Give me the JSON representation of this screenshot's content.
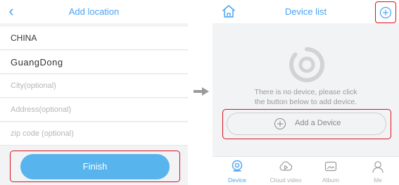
{
  "left_screen": {
    "title": "Add location",
    "back_icon": "chevron-left-icon",
    "fields": {
      "country": "CHINA",
      "province": "GuangDong",
      "city_placeholder": "City(optional)",
      "address_placeholder": "Address(optional)",
      "zip_placeholder": "zip code (optional)"
    },
    "finish_label": "Finish"
  },
  "arrow_icon": "right-arrow-icon",
  "right_screen": {
    "title": "Device list",
    "home_icon": "home-icon",
    "add_icon": "plus-circle-icon",
    "empty_message_line1": "There is no device, please click",
    "empty_message_line2": "the button below to add device.",
    "add_device_label": "Add a Device",
    "tabs": [
      {
        "label": "Device",
        "icon": "camera-icon",
        "active": true
      },
      {
        "label": "Cloud video",
        "icon": "cloud-play-icon",
        "active": false
      },
      {
        "label": "Album",
        "icon": "album-icon",
        "active": false
      },
      {
        "label": "Me",
        "icon": "person-icon",
        "active": false
      }
    ]
  },
  "colors": {
    "accent": "#4aa3f2",
    "button": "#57b4ec",
    "highlight_border": "#d9141f",
    "background": "#f2f3f5"
  }
}
